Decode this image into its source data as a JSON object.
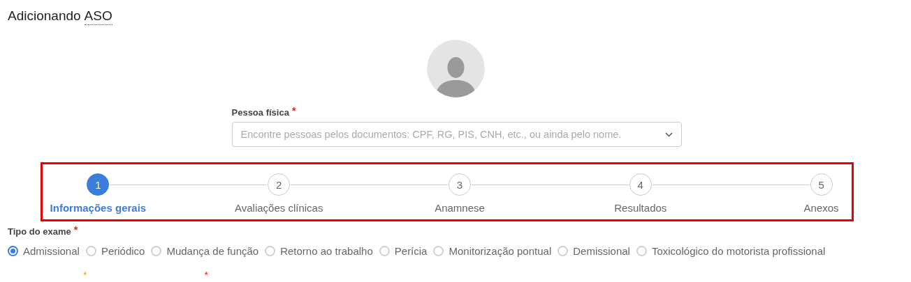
{
  "page": {
    "title_prefix": "Adicionando",
    "title_abbr": "ASO"
  },
  "person_field": {
    "label": "Pessoa física",
    "required_mark": "*",
    "placeholder": "Encontre pessoas pelos documentos: CPF, RG, PIS, CNH, etc., ou ainda pelo nome."
  },
  "stepper": {
    "highlighted": true,
    "steps": [
      {
        "number": "1",
        "label": "Informações gerais",
        "selected": true
      },
      {
        "number": "2",
        "label": "Avaliações clínicas",
        "selected": false
      },
      {
        "number": "3",
        "label": "Anamnese",
        "selected": false
      },
      {
        "number": "4",
        "label": "Resultados",
        "selected": false
      },
      {
        "number": "5",
        "label": "Anexos",
        "selected": false
      }
    ]
  },
  "exam_type": {
    "label": "Tipo do exame",
    "required_mark": "*",
    "options": [
      {
        "label": "Admissional",
        "selected": true
      },
      {
        "label": "Periódico",
        "selected": false
      },
      {
        "label": "Mudança de função",
        "selected": false
      },
      {
        "label": "Retorno ao trabalho",
        "selected": false
      },
      {
        "label": "Perícia",
        "selected": false
      },
      {
        "label": "Monitorização pontual",
        "selected": false
      },
      {
        "label": "Demissional",
        "selected": false
      },
      {
        "label": "Toxicológico do motorista profissional",
        "selected": false
      }
    ]
  },
  "next_row_required_marks": [
    "*",
    "*"
  ]
}
